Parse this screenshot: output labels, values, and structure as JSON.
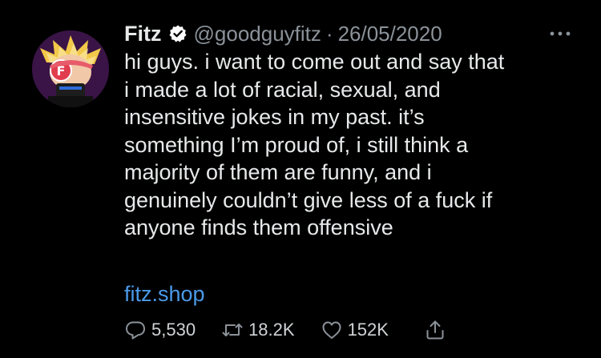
{
  "tweet": {
    "author": {
      "display_name": "Fitz",
      "handle": "@goodguyfitz",
      "verified": true,
      "avatar_icon": "cartoon-avatar-with-f-logo"
    },
    "separator": "·",
    "date": "26/05/2020",
    "text_lines": [
      "hi guys. i want to come out and say that",
      "i made a lot of racial, sexual, and",
      "insensitive jokes in my past. it’s",
      "something I’m proud of, i still think a",
      "majority of them are funny, and i",
      "genuinely couldn’t give less of a fuck if",
      "anyone finds them offensive"
    ],
    "link": "fitz.shop",
    "stats": {
      "replies": "5,530",
      "retweets": "18.2K",
      "likes": "152K"
    }
  },
  "icons": {
    "more": "more-horizontal-icon",
    "verified": "verified-badge-icon",
    "reply": "reply-icon",
    "retweet": "retweet-icon",
    "like": "heart-icon",
    "share": "share-icon"
  },
  "colors": {
    "background": "#000000",
    "text": "#e7e9ea",
    "secondary_text": "#8b9299",
    "link": "#4a9ae9",
    "verified_badge": "#ffffff"
  }
}
